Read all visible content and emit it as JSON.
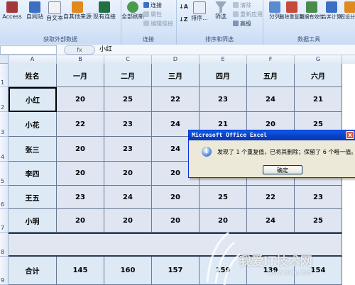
{
  "ribbon": {
    "groups": [
      {
        "title": "获取外部数据",
        "buttons": [
          "Access",
          "自网站",
          "自文本",
          "自其他来源",
          "现有连接"
        ]
      },
      {
        "title": "连接",
        "big": "全部刷新",
        "small": [
          "连接",
          "属性",
          "编辑链接"
        ]
      },
      {
        "title": "排序和筛选",
        "buttons": [
          "排序...",
          "筛选"
        ],
        "small": [
          "清除",
          "重新应用",
          "高级"
        ]
      },
      {
        "title": "数据工具",
        "buttons": [
          "分列",
          "删除重复项",
          "数据有效性",
          "合并计算",
          "假设分析"
        ]
      }
    ],
    "colors": {
      "excel": "#207245",
      "blue": "#3a6fc4",
      "orange": "#e08a1e"
    }
  },
  "formula_bar": {
    "name_box": "",
    "fx": "fx",
    "content": "小红"
  },
  "columns": [
    "A",
    "B",
    "C",
    "D",
    "E",
    "F",
    "G"
  ],
  "rows": [
    "1",
    "2",
    "3",
    "4",
    "5",
    "6",
    "7",
    "8",
    "9"
  ],
  "sheet": {
    "header": [
      "姓名",
      "一月",
      "二月",
      "三月",
      "四月",
      "五月",
      "六月"
    ],
    "data": [
      [
        "小红",
        "20",
        "25",
        "22",
        "23",
        "24",
        "21"
      ],
      [
        "小花",
        "22",
        "23",
        "24",
        "21",
        "20",
        "25"
      ],
      [
        "张三",
        "20",
        "23",
        "24",
        "",
        "",
        ""
      ],
      [
        "李四",
        "20",
        "20",
        "20",
        "",
        "",
        ""
      ],
      [
        "王五",
        "23",
        "24",
        "20",
        "25",
        "22",
        "23"
      ],
      [
        "小明",
        "20",
        "20",
        "20",
        "20",
        "24",
        "25"
      ]
    ],
    "total": [
      "合计",
      "145",
      "160",
      "157",
      "159",
      "139",
      "154"
    ]
  },
  "dialog": {
    "title": "Microsoft Office Excel",
    "close": "x",
    "icon": "i",
    "message": "发现了 1 个重复值，已将其删除；保留了 6 个唯一值。",
    "ok": "确定"
  },
  "watermark": {
    "text": "我爱IT技术网",
    "site": "www.52ij.com"
  }
}
